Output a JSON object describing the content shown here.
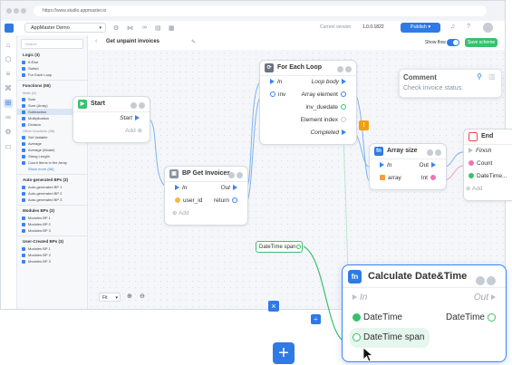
{
  "browser": {
    "url": "https://www.studio.appmaster.io"
  },
  "appbar": {
    "project_name": "AppMaster Demo",
    "version_label": "Current version:",
    "version_value": "1.0.0.1822",
    "publish_label": "Publish"
  },
  "toolbar": {
    "page_title": "Get unpaint invoices",
    "show_flow_label": "Show flow",
    "save_label": "Save scheme",
    "zoom_value": "Fit"
  },
  "sidebar": {
    "search_placeholder": "Search",
    "sections": [
      {
        "title": "Logic (3)",
        "items": [
          "If-Else",
          "Switch",
          "For Each Loop"
        ]
      },
      {
        "title": "Functions (50)",
        "sub": "Math (6)",
        "items": [
          "Sum",
          "Sum (Array)",
          "Subtraction",
          "Multiplication",
          "Division"
        ]
      },
      {
        "sub": "Other functions (86)",
        "items": [
          "Set Variable",
          "Average",
          "Average (Model)",
          "String Length",
          "Count Items in the Array"
        ],
        "link": "Show more (56)"
      },
      {
        "title": "Auto-generated BPs (3)",
        "items": [
          "Auto-generated BP 1",
          "Auto-generated BP 2",
          "Auto-generated BP 3"
        ]
      },
      {
        "title": "Modules BPs (3)",
        "items": [
          "Modules BP 1",
          "Modules BP 2",
          "Modules BP 3"
        ]
      },
      {
        "title": "User-Created BPs (3)",
        "items": [
          "Modules BP 1",
          "Modules BP 2",
          "Modules BP 3"
        ]
      }
    ]
  },
  "nodes": {
    "start": {
      "title": "Start",
      "start_label": "Start",
      "add_label": "Add"
    },
    "get_invoices": {
      "title": "BP Get Invoices",
      "in_label": "In",
      "out_label": "Out",
      "param": "user_id",
      "return_label": "return",
      "add_label": "Add"
    },
    "for_each": {
      "title": "For Each Loop",
      "in_label": "In",
      "loop_body": "Loop body",
      "inv": "inv",
      "array_element": "Array element",
      "inv_duedate": "inv_duedate",
      "element_index": "Element index",
      "completed": "Completed"
    },
    "array_size": {
      "title": "Array size",
      "in_label": "In",
      "out_label": "Out",
      "array_label": "array",
      "int_label": "Int"
    },
    "end": {
      "title": "End",
      "finish": "Finish",
      "count": "Count",
      "datetime": "DateTime...",
      "add_label": "Add"
    },
    "datetime_span": {
      "label": "DateTime span"
    },
    "calc": {
      "title": "Calculate Date&Time",
      "in_label": "In",
      "out_label": "Out",
      "datetime_in": "DateTime",
      "datetime_out": "DateTime",
      "datetime_span": "DateTime span"
    }
  },
  "comment": {
    "title": "Comment",
    "text": "Check invoice status."
  },
  "warning_icon": "warning-icon",
  "colors": {
    "accent": "#2f7ae5",
    "green": "#39c16c",
    "warning": "#f59e0b"
  }
}
